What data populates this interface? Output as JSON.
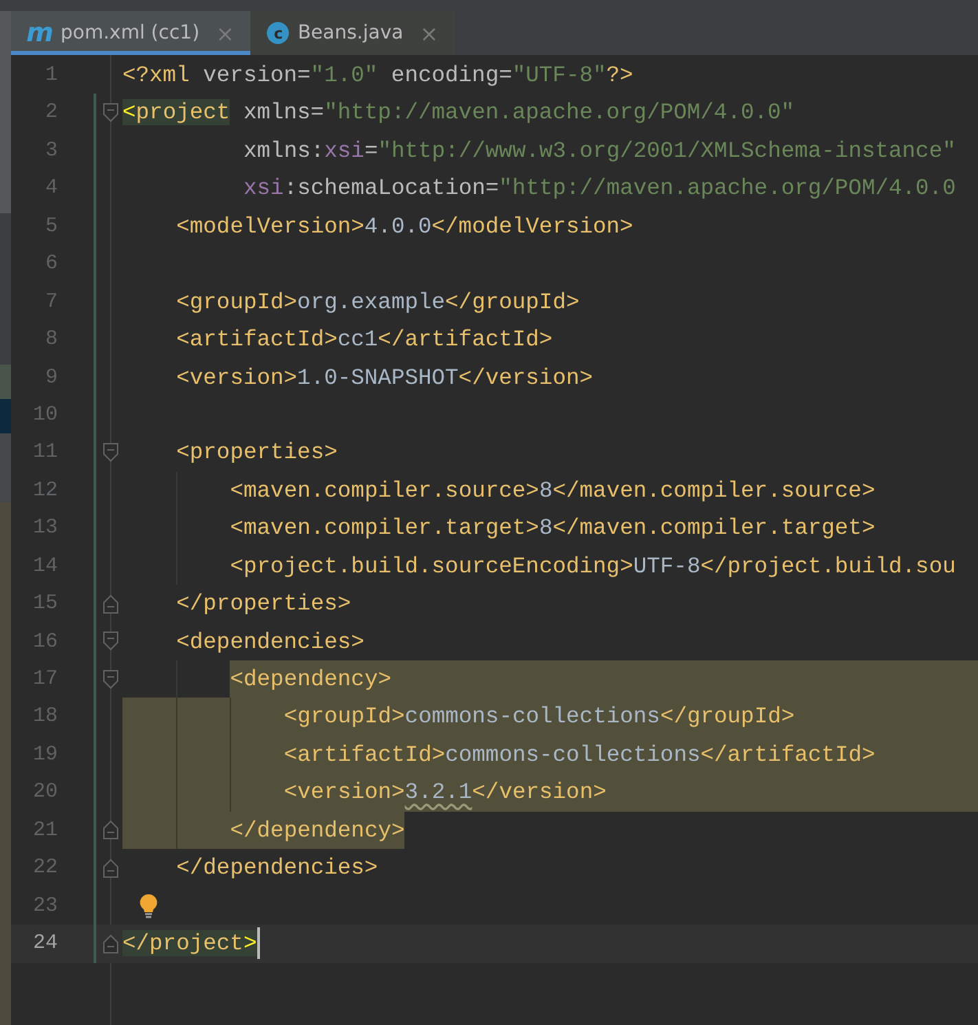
{
  "tabs": [
    {
      "kind": "maven",
      "badge": "m",
      "label": "pom.xml (cc1)",
      "close": "×",
      "selected": true
    },
    {
      "kind": "class",
      "badge": "c",
      "label": "Beans.java",
      "close": "×",
      "selected": false
    }
  ],
  "lines": [
    {
      "number": "1",
      "changed": false,
      "tokens": [
        {
          "kind": "tag",
          "text": "<?xml"
        },
        {
          "kind": "attr",
          "text": " version="
        },
        {
          "kind": "str",
          "text": "\"1.0\""
        },
        {
          "kind": "attr",
          "text": " encoding="
        },
        {
          "kind": "str",
          "text": "\"UTF-8\""
        },
        {
          "kind": "tag",
          "text": "?>"
        }
      ]
    },
    {
      "number": "2",
      "changed": true,
      "fold_start": true,
      "tokens": [
        {
          "kind": "match-bracket",
          "text": "<"
        },
        {
          "kind": "match",
          "text": "project"
        },
        {
          "kind": "attr",
          "text": " xmlns="
        },
        {
          "kind": "str",
          "text": "\"http://maven.apache.org/POM/4.0.0\""
        }
      ]
    },
    {
      "number": "3",
      "changed": true,
      "tokens": [
        {
          "kind": "attr",
          "text": "         xmlns:"
        },
        {
          "kind": "ns",
          "text": "xsi"
        },
        {
          "kind": "attr",
          "text": "="
        },
        {
          "kind": "str",
          "text": "\"http://www.w3.org/2001/XMLSchema-instance\""
        }
      ]
    },
    {
      "number": "4",
      "changed": true,
      "tokens": [
        {
          "kind": "ns",
          "text": "         xsi"
        },
        {
          "kind": "attr",
          "text": ":schemaLocation="
        },
        {
          "kind": "str",
          "text": "\"http://maven.apache.org/POM/4.0.0"
        }
      ]
    },
    {
      "number": "5",
      "changed": true,
      "tokens": [
        {
          "kind": "tag",
          "text": "    <modelVersion>"
        },
        {
          "kind": "text",
          "text": "4.0.0"
        },
        {
          "kind": "tag",
          "text": "</modelVersion>"
        }
      ]
    },
    {
      "number": "6",
      "changed": true
    },
    {
      "number": "7",
      "changed": true,
      "tokens": [
        {
          "kind": "tag",
          "text": "    <groupId>"
        },
        {
          "kind": "text",
          "text": "org.example"
        },
        {
          "kind": "tag",
          "text": "</groupId>"
        }
      ]
    },
    {
      "number": "8",
      "changed": true,
      "tokens": [
        {
          "kind": "tag",
          "text": "    <artifactId>"
        },
        {
          "kind": "text",
          "text": "cc1"
        },
        {
          "kind": "tag",
          "text": "</artifactId>"
        }
      ]
    },
    {
      "number": "9",
      "changed": true,
      "tokens": [
        {
          "kind": "tag",
          "text": "    <version>"
        },
        {
          "kind": "text",
          "text": "1.0-SNAPSHOT"
        },
        {
          "kind": "tag",
          "text": "</version>"
        }
      ]
    },
    {
      "number": "10",
      "changed": true
    },
    {
      "number": "11",
      "changed": true,
      "fold_start": true,
      "tokens": [
        {
          "kind": "tag",
          "text": "    <properties>"
        }
      ]
    },
    {
      "number": "12",
      "changed": true,
      "tokens": [
        {
          "kind": "tag",
          "text": "        <maven.compiler.source>"
        },
        {
          "kind": "text",
          "text": "8"
        },
        {
          "kind": "tag",
          "text": "</maven.compiler.source>"
        }
      ]
    },
    {
      "number": "13",
      "changed": true,
      "tokens": [
        {
          "kind": "tag",
          "text": "        <maven.compiler.target>"
        },
        {
          "kind": "text",
          "text": "8"
        },
        {
          "kind": "tag",
          "text": "</maven.compiler.target>"
        }
      ]
    },
    {
      "number": "14",
      "changed": true,
      "tokens": [
        {
          "kind": "tag",
          "text": "        <project.build.sourceEncoding>"
        },
        {
          "kind": "text",
          "text": "UTF-8"
        },
        {
          "kind": "tag",
          "text": "</project.build.sou"
        }
      ]
    },
    {
      "number": "15",
      "changed": true,
      "fold_end": true,
      "tokens": [
        {
          "kind": "tag",
          "text": "    </properties>"
        }
      ]
    },
    {
      "number": "16",
      "changed": true,
      "fold_start": true,
      "tokens": [
        {
          "kind": "tag",
          "text": "    <dependencies>"
        }
      ]
    },
    {
      "number": "17",
      "changed": true,
      "fold_start": true,
      "block_start": true,
      "tokens": [
        {
          "kind": "tag",
          "text": "        <dependency>"
        }
      ]
    },
    {
      "number": "18",
      "changed": true,
      "block_body": true,
      "tokens": [
        {
          "kind": "tag",
          "text": "            <groupId>"
        },
        {
          "kind": "text",
          "text": "commons-collections"
        },
        {
          "kind": "tag",
          "text": "</groupId>"
        }
      ]
    },
    {
      "number": "19",
      "changed": true,
      "block_body": true,
      "tokens": [
        {
          "kind": "tag",
          "text": "            <artifactId>"
        },
        {
          "kind": "text",
          "text": "commons-collections"
        },
        {
          "kind": "tag",
          "text": "</artifactId>"
        }
      ]
    },
    {
      "number": "20",
      "changed": true,
      "block_body": true,
      "tokens": [
        {
          "kind": "tag",
          "text": "            <version>"
        },
        {
          "kind": "warn",
          "text": "3.2.1"
        },
        {
          "kind": "tag",
          "text": "</version>"
        }
      ]
    },
    {
      "number": "21",
      "changed": true,
      "fold_end": true,
      "block_end": true,
      "tokens": [
        {
          "kind": "tag",
          "text": "        </dependency>"
        }
      ]
    },
    {
      "number": "22",
      "changed": true,
      "fold_end": true,
      "tokens": [
        {
          "kind": "tag",
          "text": "    </dependencies>"
        }
      ]
    },
    {
      "number": "23",
      "changed": true,
      "bulb": true
    },
    {
      "number": "24",
      "changed": true,
      "fold_end": true,
      "current": true,
      "caret": true,
      "tokens": [
        {
          "kind": "match",
          "text": "</project"
        },
        {
          "kind": "match-bracket",
          "text": ">"
        }
      ]
    }
  ]
}
